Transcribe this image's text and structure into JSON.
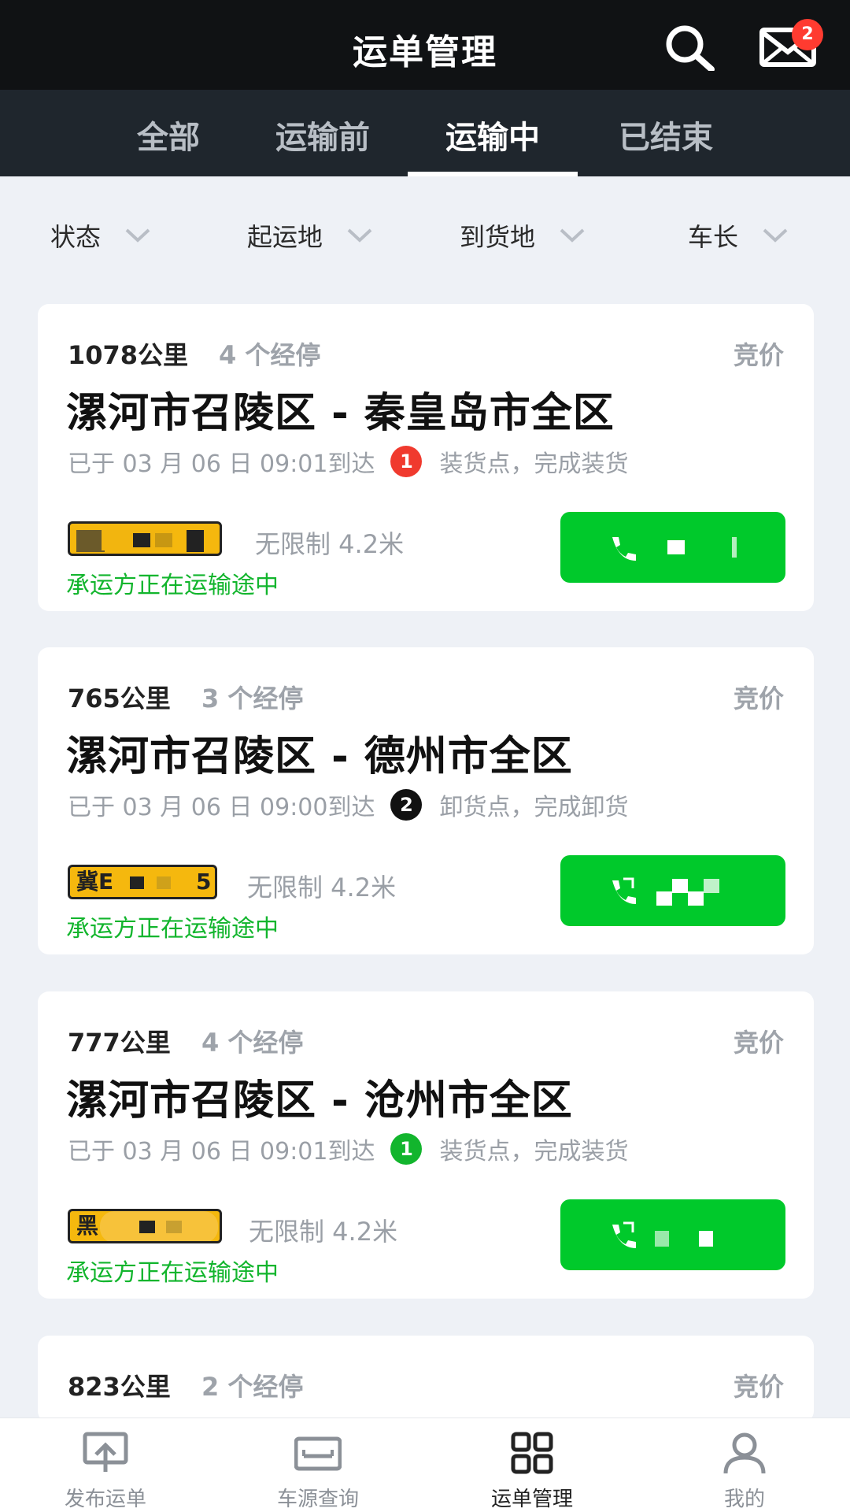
{
  "header": {
    "title": "运单管理",
    "badge_count": "2"
  },
  "tabs": [
    {
      "label": "全部",
      "active": false
    },
    {
      "label": "运输前",
      "active": false
    },
    {
      "label": "运输中",
      "active": true
    },
    {
      "label": "已结束",
      "active": false
    }
  ],
  "filters": [
    {
      "label": "状态"
    },
    {
      "label": "起运地"
    },
    {
      "label": "到货地"
    },
    {
      "label": "车长"
    }
  ],
  "orders": [
    {
      "distance": "1078公里",
      "stops": "4 个经停",
      "mode": "竞价",
      "route": "漯河市召陵区 - 秦皇岛市全区",
      "arrived": "已于 03 月 06 日 09:01到达",
      "point_no": "1",
      "point_color": "#f03a2e",
      "point_desc": "装货点，完成装货",
      "plate": "",
      "spec": "无限制 4.2米",
      "status": "承运方正在运输途中"
    },
    {
      "distance": "765公里",
      "stops": "3 个经停",
      "mode": "竞价",
      "route": "漯河市召陵区 - 德州市全区",
      "arrived": "已于 03 月 06 日 09:00到达",
      "point_no": "2",
      "point_color": "#111111",
      "point_desc": "卸货点，完成卸货",
      "plate": "冀E",
      "plate_tail": "5",
      "spec": "无限制 4.2米",
      "status": "承运方正在运输途中"
    },
    {
      "distance": "777公里",
      "stops": "4 个经停",
      "mode": "竞价",
      "route": "漯河市召陵区 - 沧州市全区",
      "arrived": "已于 03 月 06 日 09:01到达",
      "point_no": "1",
      "point_color": "#12b52d",
      "point_desc": "装货点，完成装货",
      "plate": "黑",
      "spec": "无限制 4.2米",
      "status": "承运方正在运输途中"
    },
    {
      "distance": "823公里",
      "stops": "2 个经停",
      "mode": "竞价"
    }
  ],
  "bottom_nav": [
    {
      "label": "发布运单",
      "icon": "publish-icon",
      "active": false
    },
    {
      "label": "车源查询",
      "icon": "vehicle-search-icon",
      "active": false
    },
    {
      "label": "运单管理",
      "icon": "grid-icon",
      "active": true
    },
    {
      "label": "我的",
      "icon": "user-icon",
      "active": false
    }
  ]
}
